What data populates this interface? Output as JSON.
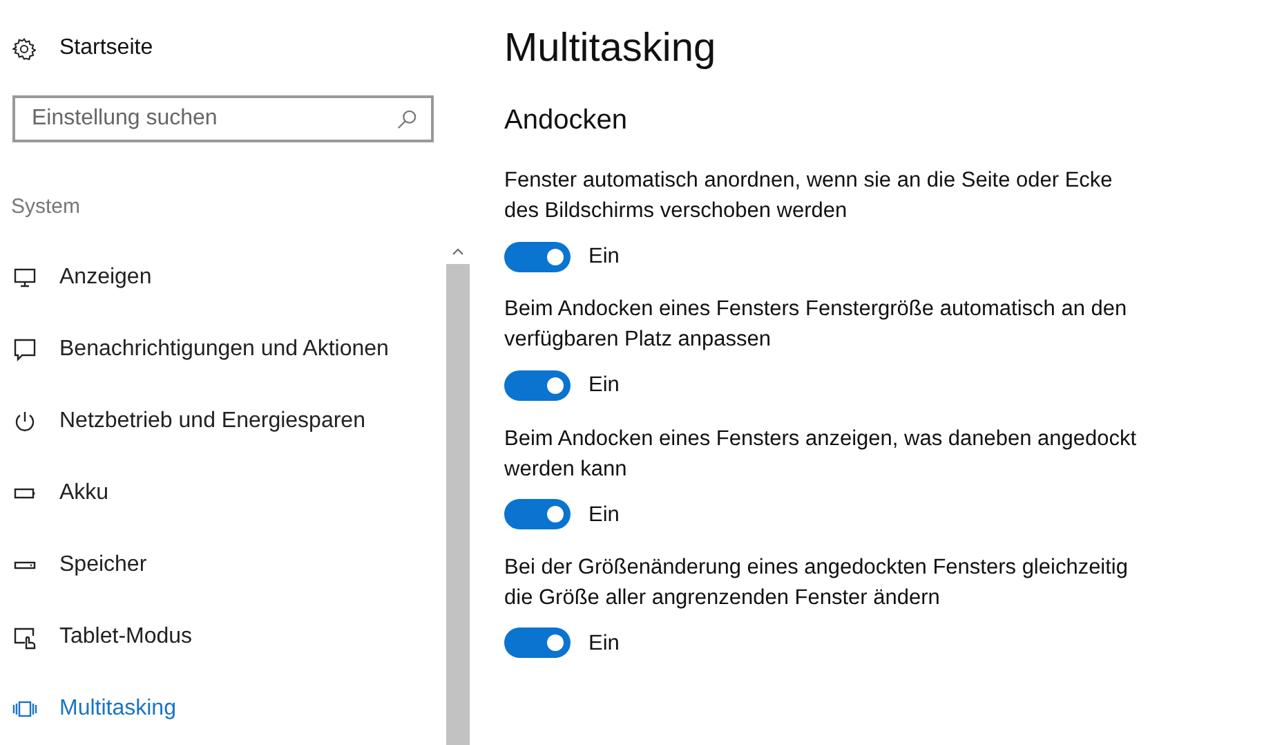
{
  "sidebar": {
    "home": "Startseite",
    "search": {
      "placeholder": "Einstellung suchen"
    },
    "section": "System",
    "items": [
      {
        "label": "Anzeigen",
        "selected": false
      },
      {
        "label": "Benachrichtigungen und Aktionen",
        "selected": false
      },
      {
        "label": "Netzbetrieb und Energiesparen",
        "selected": false
      },
      {
        "label": "Akku",
        "selected": false
      },
      {
        "label": "Speicher",
        "selected": false
      },
      {
        "label": "Tablet-Modus",
        "selected": false
      },
      {
        "label": "Multitasking",
        "selected": true
      }
    ]
  },
  "page": {
    "title": "Multitasking",
    "section": "Andocken",
    "settings": [
      {
        "description": "Fenster automatisch anordnen, wenn sie an die Seite oder Ecke des Bildschirms verschoben werden",
        "on": true,
        "state": "Ein"
      },
      {
        "description": "Beim Andocken eines Fensters Fenstergröße automatisch an den verfügbaren Platz anpassen",
        "on": true,
        "state": "Ein"
      },
      {
        "description": "Beim Andocken eines Fensters anzeigen, was daneben angedockt werden kann",
        "on": true,
        "state": "Ein"
      },
      {
        "description": "Bei der Größenänderung eines angedockten Fensters gleichzeitig die Größe aller angrenzenden Fenster ändern",
        "on": true,
        "state": "Ein"
      }
    ]
  }
}
